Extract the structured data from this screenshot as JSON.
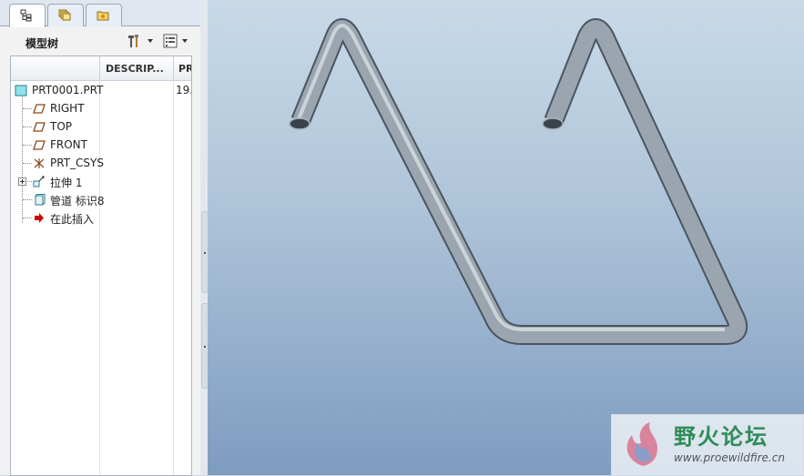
{
  "tabs": [
    {
      "name": "model-tree-tab",
      "icon": "model-tree-icon",
      "active": true
    },
    {
      "name": "layers-tab",
      "icon": "layers-icon",
      "active": false
    },
    {
      "name": "favorites-tab",
      "icon": "folder-star-icon",
      "active": false
    }
  ],
  "pane": {
    "title": "模型树",
    "settings_icon": "tools-icon",
    "show_icon": "list-icon"
  },
  "columns": [
    {
      "label": "DESCRIP..."
    },
    {
      "label": "PR"
    }
  ],
  "tree": {
    "root": {
      "label": "PRT0001.PRT",
      "col2": "19.",
      "icon": "part-icon"
    },
    "items": [
      {
        "label": "RIGHT",
        "icon": "datum-plane-icon",
        "expandable": false
      },
      {
        "label": "TOP",
        "icon": "datum-plane-icon",
        "expandable": false
      },
      {
        "label": "FRONT",
        "icon": "datum-plane-icon",
        "expandable": false
      },
      {
        "label": "PRT_CSYS",
        "icon": "csys-icon",
        "expandable": false
      },
      {
        "label": "拉伸 1",
        "icon": "extrude-icon",
        "expandable": true
      },
      {
        "label": "管道 标识8",
        "icon": "pipe-icon",
        "expandable": false
      },
      {
        "label": "在此插入",
        "icon": "insert-here-icon",
        "expandable": false
      }
    ]
  },
  "watermark": {
    "title": "野火论坛",
    "url": "www.proewildfire.cn"
  },
  "colors": {
    "viewport_top": "#c8dae8",
    "viewport_bottom": "#7e9cc0",
    "pipe": "#8e99a4",
    "insert_arrow": "#d00000"
  }
}
